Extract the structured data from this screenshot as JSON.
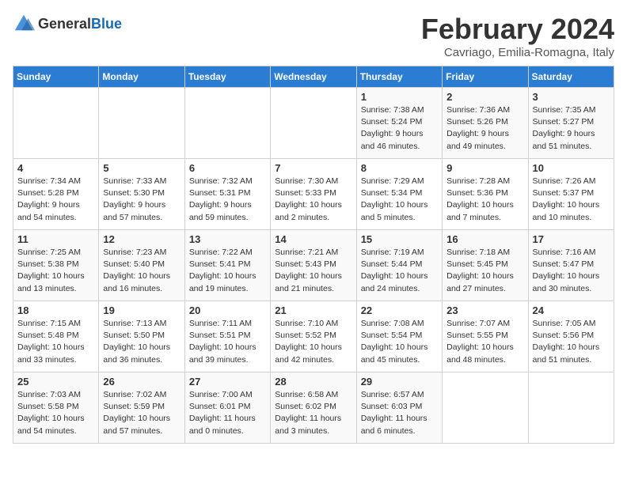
{
  "header": {
    "logo_general": "General",
    "logo_blue": "Blue",
    "month_title": "February 2024",
    "subtitle": "Cavriago, Emilia-Romagna, Italy"
  },
  "days_of_week": [
    "Sunday",
    "Monday",
    "Tuesday",
    "Wednesday",
    "Thursday",
    "Friday",
    "Saturday"
  ],
  "weeks": [
    [
      {
        "day": "",
        "info": ""
      },
      {
        "day": "",
        "info": ""
      },
      {
        "day": "",
        "info": ""
      },
      {
        "day": "",
        "info": ""
      },
      {
        "day": "1",
        "info": "Sunrise: 7:38 AM\nSunset: 5:24 PM\nDaylight: 9 hours\nand 46 minutes."
      },
      {
        "day": "2",
        "info": "Sunrise: 7:36 AM\nSunset: 5:26 PM\nDaylight: 9 hours\nand 49 minutes."
      },
      {
        "day": "3",
        "info": "Sunrise: 7:35 AM\nSunset: 5:27 PM\nDaylight: 9 hours\nand 51 minutes."
      }
    ],
    [
      {
        "day": "4",
        "info": "Sunrise: 7:34 AM\nSunset: 5:28 PM\nDaylight: 9 hours\nand 54 minutes."
      },
      {
        "day": "5",
        "info": "Sunrise: 7:33 AM\nSunset: 5:30 PM\nDaylight: 9 hours\nand 57 minutes."
      },
      {
        "day": "6",
        "info": "Sunrise: 7:32 AM\nSunset: 5:31 PM\nDaylight: 9 hours\nand 59 minutes."
      },
      {
        "day": "7",
        "info": "Sunrise: 7:30 AM\nSunset: 5:33 PM\nDaylight: 10 hours\nand 2 minutes."
      },
      {
        "day": "8",
        "info": "Sunrise: 7:29 AM\nSunset: 5:34 PM\nDaylight: 10 hours\nand 5 minutes."
      },
      {
        "day": "9",
        "info": "Sunrise: 7:28 AM\nSunset: 5:36 PM\nDaylight: 10 hours\nand 7 minutes."
      },
      {
        "day": "10",
        "info": "Sunrise: 7:26 AM\nSunset: 5:37 PM\nDaylight: 10 hours\nand 10 minutes."
      }
    ],
    [
      {
        "day": "11",
        "info": "Sunrise: 7:25 AM\nSunset: 5:38 PM\nDaylight: 10 hours\nand 13 minutes."
      },
      {
        "day": "12",
        "info": "Sunrise: 7:23 AM\nSunset: 5:40 PM\nDaylight: 10 hours\nand 16 minutes."
      },
      {
        "day": "13",
        "info": "Sunrise: 7:22 AM\nSunset: 5:41 PM\nDaylight: 10 hours\nand 19 minutes."
      },
      {
        "day": "14",
        "info": "Sunrise: 7:21 AM\nSunset: 5:43 PM\nDaylight: 10 hours\nand 21 minutes."
      },
      {
        "day": "15",
        "info": "Sunrise: 7:19 AM\nSunset: 5:44 PM\nDaylight: 10 hours\nand 24 minutes."
      },
      {
        "day": "16",
        "info": "Sunrise: 7:18 AM\nSunset: 5:45 PM\nDaylight: 10 hours\nand 27 minutes."
      },
      {
        "day": "17",
        "info": "Sunrise: 7:16 AM\nSunset: 5:47 PM\nDaylight: 10 hours\nand 30 minutes."
      }
    ],
    [
      {
        "day": "18",
        "info": "Sunrise: 7:15 AM\nSunset: 5:48 PM\nDaylight: 10 hours\nand 33 minutes."
      },
      {
        "day": "19",
        "info": "Sunrise: 7:13 AM\nSunset: 5:50 PM\nDaylight: 10 hours\nand 36 minutes."
      },
      {
        "day": "20",
        "info": "Sunrise: 7:11 AM\nSunset: 5:51 PM\nDaylight: 10 hours\nand 39 minutes."
      },
      {
        "day": "21",
        "info": "Sunrise: 7:10 AM\nSunset: 5:52 PM\nDaylight: 10 hours\nand 42 minutes."
      },
      {
        "day": "22",
        "info": "Sunrise: 7:08 AM\nSunset: 5:54 PM\nDaylight: 10 hours\nand 45 minutes."
      },
      {
        "day": "23",
        "info": "Sunrise: 7:07 AM\nSunset: 5:55 PM\nDaylight: 10 hours\nand 48 minutes."
      },
      {
        "day": "24",
        "info": "Sunrise: 7:05 AM\nSunset: 5:56 PM\nDaylight: 10 hours\nand 51 minutes."
      }
    ],
    [
      {
        "day": "25",
        "info": "Sunrise: 7:03 AM\nSunset: 5:58 PM\nDaylight: 10 hours\nand 54 minutes."
      },
      {
        "day": "26",
        "info": "Sunrise: 7:02 AM\nSunset: 5:59 PM\nDaylight: 10 hours\nand 57 minutes."
      },
      {
        "day": "27",
        "info": "Sunrise: 7:00 AM\nSunset: 6:01 PM\nDaylight: 11 hours\nand 0 minutes."
      },
      {
        "day": "28",
        "info": "Sunrise: 6:58 AM\nSunset: 6:02 PM\nDaylight: 11 hours\nand 3 minutes."
      },
      {
        "day": "29",
        "info": "Sunrise: 6:57 AM\nSunset: 6:03 PM\nDaylight: 11 hours\nand 6 minutes."
      },
      {
        "day": "",
        "info": ""
      },
      {
        "day": "",
        "info": ""
      }
    ]
  ]
}
